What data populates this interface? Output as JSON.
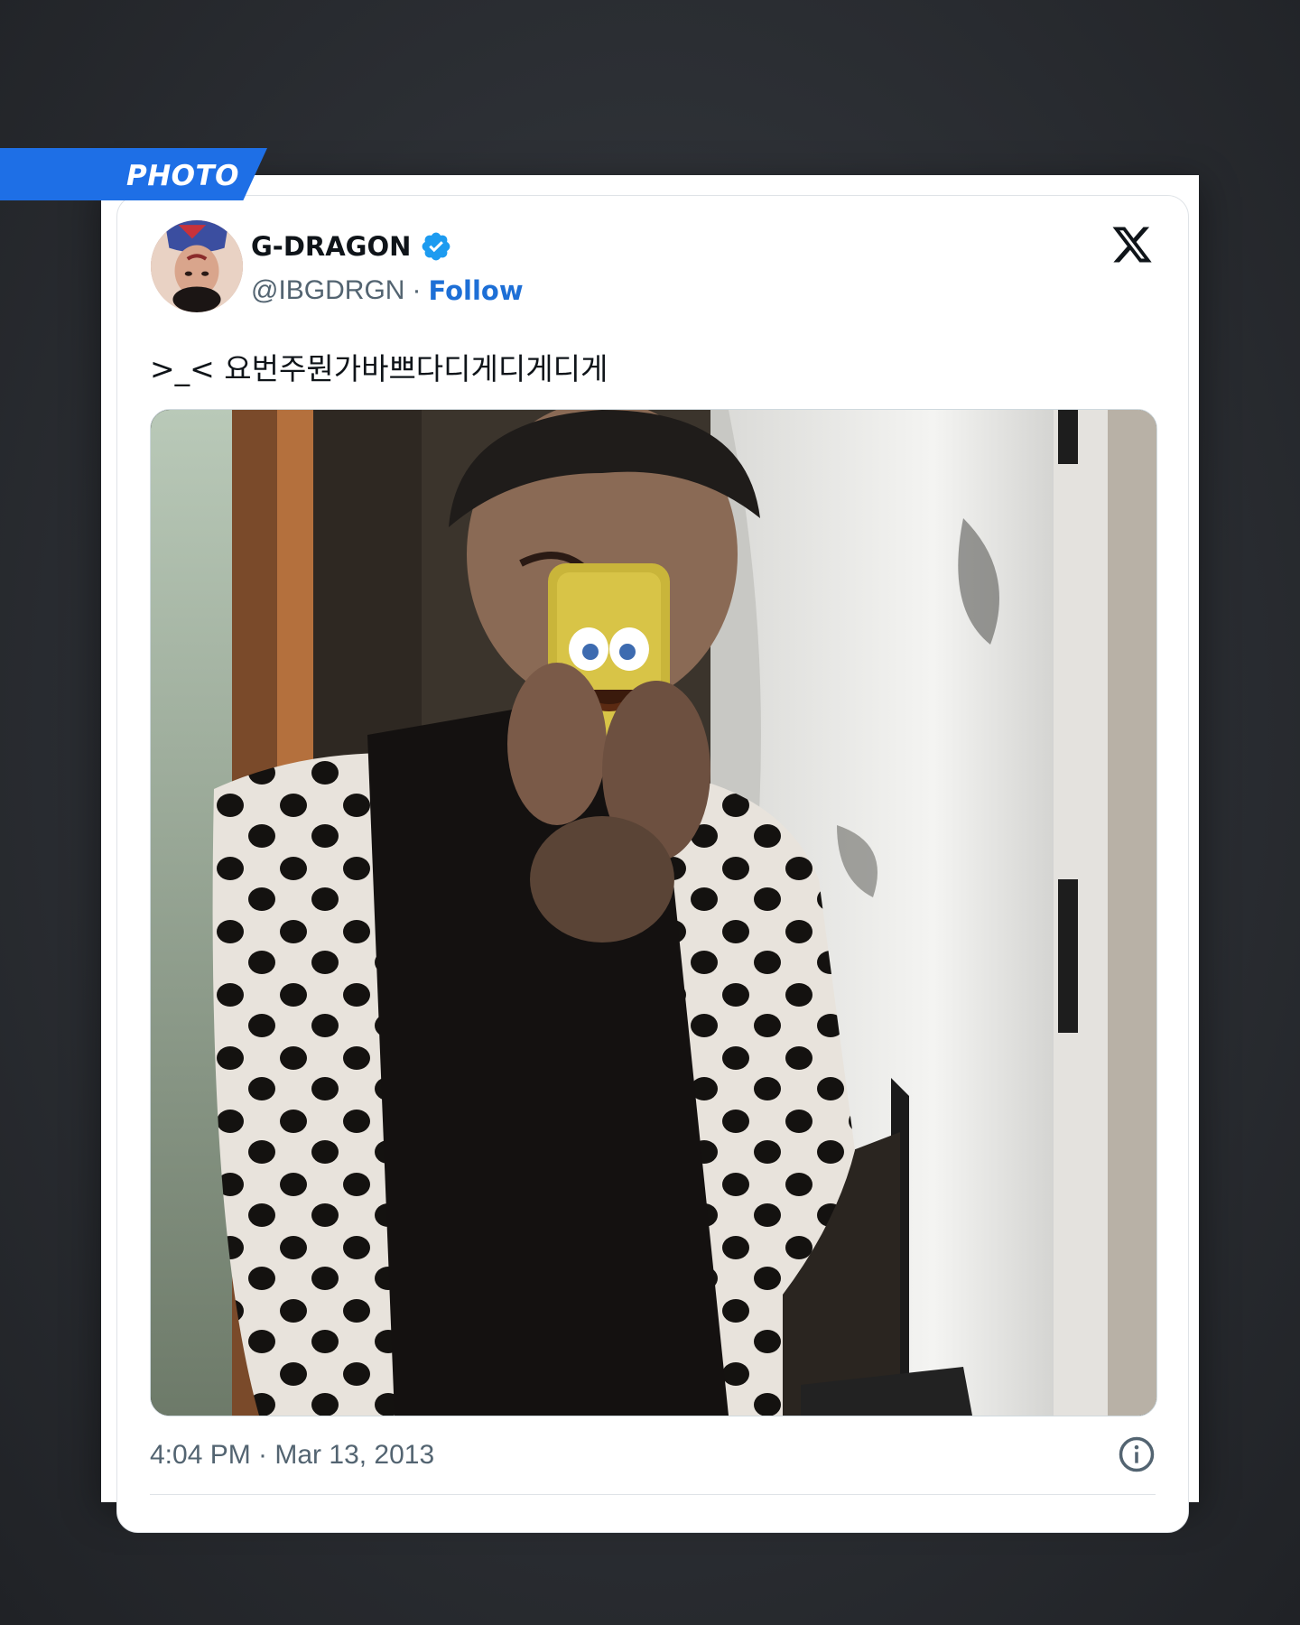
{
  "badge": {
    "label": "PHOTO"
  },
  "tweet": {
    "display_name": "G-DRAGON",
    "handle": "@IBGDRGN",
    "separator": "·",
    "follow_label": "Follow",
    "text": ">_< 요번주뭔가바쁘다디게디게디게",
    "timestamp": "4:04 PM · Mar 13, 2013",
    "verified": true
  },
  "colors": {
    "badge": "#1e6fe6",
    "follow": "#1d6fd6",
    "verified": "#1d9bf0",
    "secondary_text": "#536471"
  },
  "icons": {
    "verified": "verified-badge-icon",
    "platform": "x-logo-icon",
    "info": "info-icon"
  }
}
